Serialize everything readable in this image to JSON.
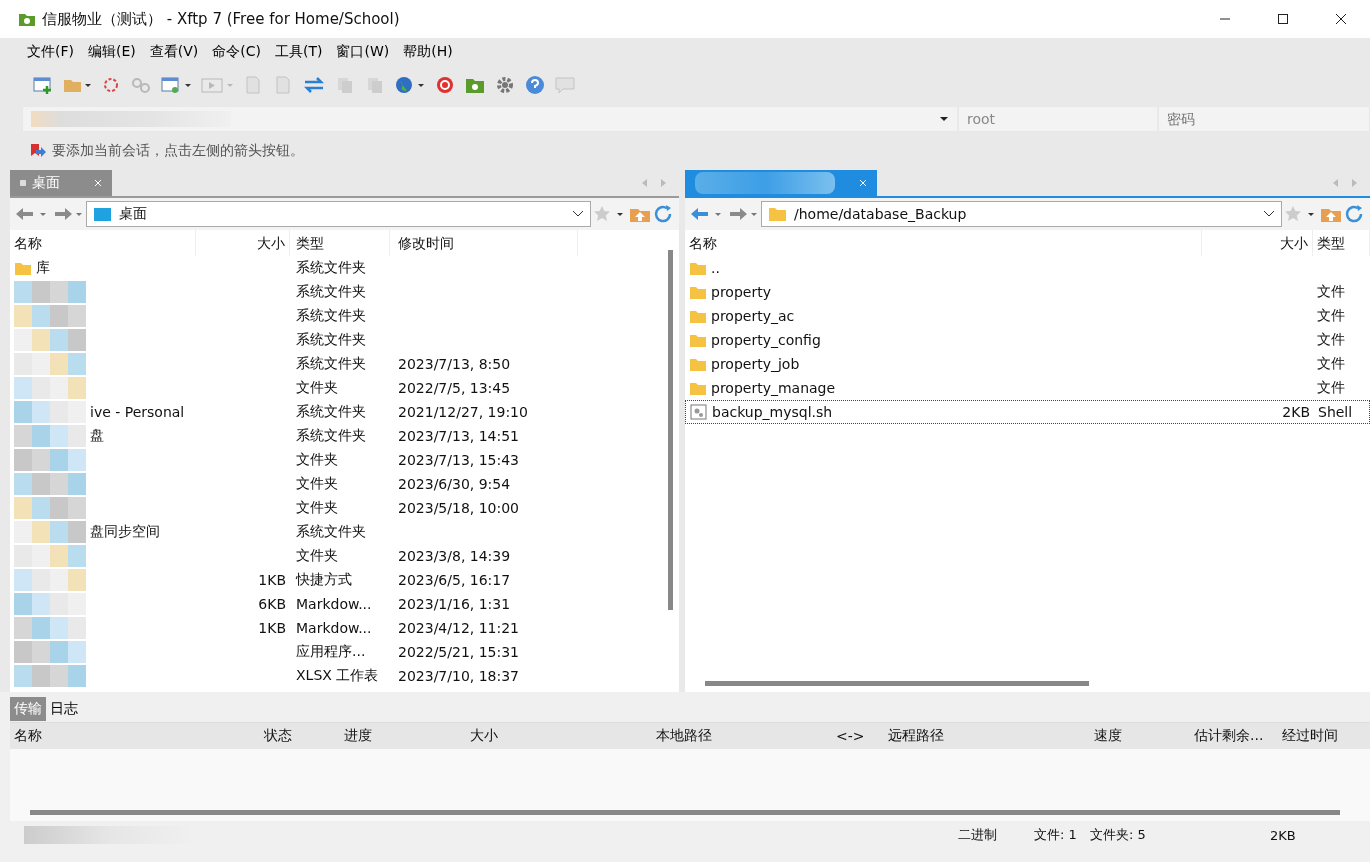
{
  "window": {
    "title": "信服物业（测试） - Xftp 7 (Free for Home/School)"
  },
  "menu": [
    "文件(F)",
    "编辑(E)",
    "查看(V)",
    "命令(C)",
    "工具(T)",
    "窗口(W)",
    "帮助(H)"
  ],
  "address_bar": {
    "user": "root",
    "password_placeholder": "密码"
  },
  "hint": "要添加当前会话，点击左侧的箭头按钮。",
  "local": {
    "tab": {
      "label": "桌面",
      "selected": false
    },
    "path": "桌面",
    "columns": [
      "名称",
      "大小",
      "类型",
      "修改时间"
    ],
    "rows": [
      {
        "kind": "folder",
        "name": "库",
        "redacted": false,
        "size": "",
        "type": "系统文件夹",
        "modified": ""
      },
      {
        "kind": "blur",
        "name": "",
        "redacted": true,
        "size": "",
        "type": "系统文件夹",
        "modified": ""
      },
      {
        "kind": "blur",
        "name": "",
        "redacted": true,
        "size": "",
        "type": "系统文件夹",
        "modified": ""
      },
      {
        "kind": "blur",
        "name": "",
        "redacted": true,
        "size": "",
        "type": "系统文件夹",
        "modified": ""
      },
      {
        "kind": "blur",
        "name": "",
        "redacted": true,
        "size": "",
        "type": "系统文件夹",
        "modified": "2023/7/13, 8:50"
      },
      {
        "kind": "blur",
        "name": "",
        "redacted": true,
        "size": "",
        "type": "文件夹",
        "modified": "2022/7/5, 13:45"
      },
      {
        "kind": "blur",
        "name": "ive - Personal",
        "redacted": true,
        "size": "",
        "type": "系统文件夹",
        "modified": "2021/12/27, 19:10"
      },
      {
        "kind": "blur",
        "name": "盘",
        "redacted": true,
        "size": "",
        "type": "系统文件夹",
        "modified": "2023/7/13, 14:51"
      },
      {
        "kind": "blur",
        "name": "",
        "redacted": true,
        "size": "",
        "type": "文件夹",
        "modified": "2023/7/13, 15:43"
      },
      {
        "kind": "blur",
        "name": "",
        "redacted": true,
        "size": "",
        "type": "文件夹",
        "modified": "2023/6/30, 9:54"
      },
      {
        "kind": "blur",
        "name": "",
        "redacted": true,
        "size": "",
        "type": "文件夹",
        "modified": "2023/5/18, 10:00"
      },
      {
        "kind": "blur",
        "name": "盘同步空间",
        "redacted": true,
        "size": "",
        "type": "系统文件夹",
        "modified": ""
      },
      {
        "kind": "blur",
        "name": "",
        "redacted": true,
        "size": "",
        "type": "文件夹",
        "modified": "2023/3/8, 14:39"
      },
      {
        "kind": "blur",
        "name": "",
        "redacted": true,
        "size": "1KB",
        "type": "快捷方式",
        "modified": "2023/6/5, 16:17"
      },
      {
        "kind": "blur",
        "name": "",
        "redacted": true,
        "size": "6KB",
        "type": "Markdow...",
        "modified": "2023/1/16, 1:31"
      },
      {
        "kind": "blur",
        "name": "",
        "redacted": true,
        "size": "1KB",
        "type": "Markdow...",
        "modified": "2023/4/12, 11:21"
      },
      {
        "kind": "blur",
        "name": "",
        "redacted": true,
        "size": "",
        "type": "应用程序...",
        "modified": "2022/5/21, 15:31"
      },
      {
        "kind": "blur",
        "name": "",
        "redacted": true,
        "size": "",
        "type": "XLSX 工作表",
        "modified": "2023/7/10, 18:37"
      }
    ]
  },
  "remote": {
    "tab": {
      "selected": true
    },
    "path": "/home/database_Backup",
    "columns": [
      "名称",
      "大小",
      "类型"
    ],
    "rows": [
      {
        "kind": "folder",
        "name": "..",
        "size": "",
        "type": "",
        "focused": false
      },
      {
        "kind": "folder",
        "name": "property",
        "size": "",
        "type": "文件",
        "focused": false
      },
      {
        "kind": "folder",
        "name": "property_ac",
        "size": "",
        "type": "文件",
        "focused": false
      },
      {
        "kind": "folder",
        "name": "property_config",
        "size": "",
        "type": "文件",
        "focused": false
      },
      {
        "kind": "folder",
        "name": "property_job",
        "size": "",
        "type": "文件",
        "focused": false
      },
      {
        "kind": "folder",
        "name": "property_manage",
        "size": "",
        "type": "文件",
        "focused": false
      },
      {
        "kind": "file",
        "name": "backup_mysql.sh",
        "size": "2KB",
        "type": "Shell",
        "focused": true
      }
    ]
  },
  "transfer": {
    "tabs": [
      {
        "label": "传输",
        "selected": true
      },
      {
        "label": "日志",
        "selected": false
      }
    ],
    "columns": [
      "名称",
      "状态",
      "进度",
      "大小",
      "本地路径",
      "<->",
      "远程路径",
      "速度",
      "估计剩余...",
      "经过时间"
    ]
  },
  "status_bar": {
    "mode": "二进制",
    "files": "文件: 1",
    "folders": "文件夹: 5",
    "size": "2KB"
  }
}
